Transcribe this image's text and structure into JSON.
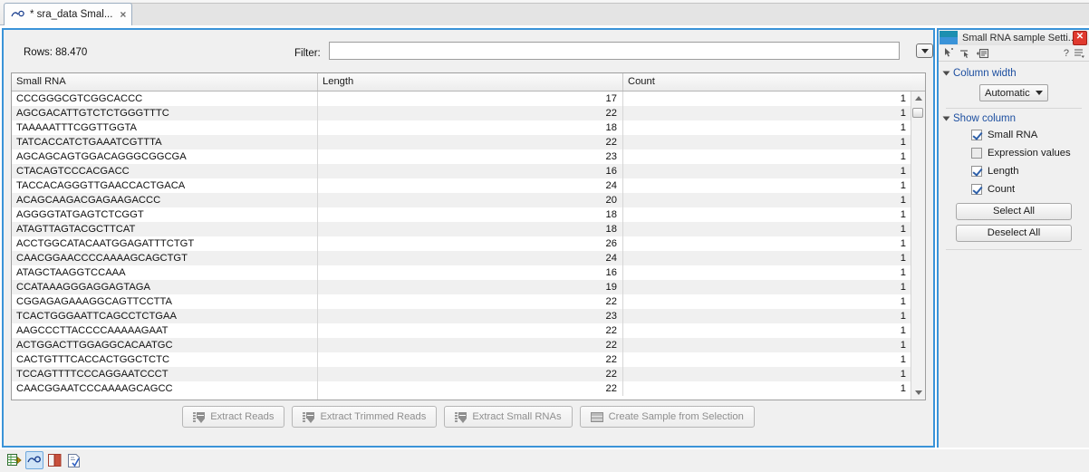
{
  "tab": {
    "title": "* sra_data Smal...",
    "close_label": "×",
    "icon": "small-rna-icon"
  },
  "toolbar": {
    "rows_label": "Rows: 88.470",
    "filter_label": "Filter:",
    "filter_value": "",
    "filter_placeholder": "",
    "filter_menu_icon": "caret-down-icon"
  },
  "table": {
    "columns": [
      "Small RNA",
      "Length",
      "Count"
    ],
    "rows": [
      {
        "seq": "CCCGGGCGTCGGCACCC",
        "length": "17",
        "count": "1"
      },
      {
        "seq": "AGCGACATTGTCTCTGGGTTTC",
        "length": "22",
        "count": "1"
      },
      {
        "seq": "TAAAAATTTCGGTTGGTA",
        "length": "18",
        "count": "1"
      },
      {
        "seq": "TATCACCATCTGAAATCGTTTA",
        "length": "22",
        "count": "1"
      },
      {
        "seq": "AGCAGCAGTGGACAGGGCGGCGA",
        "length": "23",
        "count": "1"
      },
      {
        "seq": "CTACAGTCCCACGACC",
        "length": "16",
        "count": "1"
      },
      {
        "seq": "TACCACAGGGTTGAACCACTGACA",
        "length": "24",
        "count": "1"
      },
      {
        "seq": "ACAGCAAGACGAGAAGACCC",
        "length": "20",
        "count": "1"
      },
      {
        "seq": "AGGGGTATGAGTCTCGGT",
        "length": "18",
        "count": "1"
      },
      {
        "seq": "ATAGTTAGTACGCTTCAT",
        "length": "18",
        "count": "1"
      },
      {
        "seq": "ACCTGGCATACAATGGAGATTTCTGT",
        "length": "26",
        "count": "1"
      },
      {
        "seq": "CAACGGAACCCCAAAAGCAGCTGT",
        "length": "24",
        "count": "1"
      },
      {
        "seq": "ATAGCTAAGGTCCAAA",
        "length": "16",
        "count": "1"
      },
      {
        "seq": "CCATAAAGGGAGGAGTAGA",
        "length": "19",
        "count": "1"
      },
      {
        "seq": "CGGAGAGAAAGGCAGTTCCTTA",
        "length": "22",
        "count": "1"
      },
      {
        "seq": "TCACTGGGAATTCAGCCTCTGAA",
        "length": "23",
        "count": "1"
      },
      {
        "seq": "AAGCCCTTACCCCAAAAAGAAT",
        "length": "22",
        "count": "1"
      },
      {
        "seq": "ACTGGACTTGGAGGCACAATGC",
        "length": "22",
        "count": "1"
      },
      {
        "seq": "CACTGTTTCACCACTGGCTCTC",
        "length": "22",
        "count": "1"
      },
      {
        "seq": "TCCAGTTTTCCCAGGAATCCCT",
        "length": "22",
        "count": "1"
      },
      {
        "seq": "CAACGGAATCCCAAAAGCAGCC",
        "length": "22",
        "count": "1"
      }
    ],
    "scroll_up_icon": "triangle-up-icon",
    "scroll_down_icon": "triangle-down-icon"
  },
  "actions": [
    {
      "label": "Extract Reads",
      "icon": "extract-icon"
    },
    {
      "label": "Extract Trimmed Reads",
      "icon": "extract-icon"
    },
    {
      "label": "Extract Small RNAs",
      "icon": "extract-icon"
    },
    {
      "label": "Create Sample from Selection",
      "icon": "table-icon"
    }
  ],
  "settings": {
    "title": "Small RNA sample Setti...",
    "close_label": "✕",
    "toolbar_icons": [
      "pointer-icon",
      "pointer-drag-icon",
      "copy-settings-icon"
    ],
    "help_label": "?",
    "menu_icon": "list-menu-icon",
    "sections": {
      "column_width": {
        "title": "Column width",
        "value": "Automatic",
        "caret_icon": "caret-down-icon"
      },
      "show_column": {
        "title": "Show column",
        "checkboxes": [
          {
            "label": "Small RNA",
            "checked": true
          },
          {
            "label": "Expression values",
            "checked": false
          },
          {
            "label": "Length",
            "checked": true
          },
          {
            "label": "Count",
            "checked": true
          }
        ],
        "select_all_label": "Select All",
        "deselect_all_label": "Deselect All"
      }
    }
  },
  "statusbar": {
    "icons": [
      {
        "name": "table-view-icon",
        "selected": false
      },
      {
        "name": "small-rna-view-icon",
        "selected": true
      },
      {
        "name": "book-view-icon",
        "selected": false
      },
      {
        "name": "report-view-icon",
        "selected": false
      }
    ]
  },
  "colors": {
    "accent": "#3a93d8",
    "panel_bg": "#f0f0f0",
    "row_alt": "#f0f0f0",
    "link": "#1d4fa0",
    "close_red": "#e03a2f"
  }
}
